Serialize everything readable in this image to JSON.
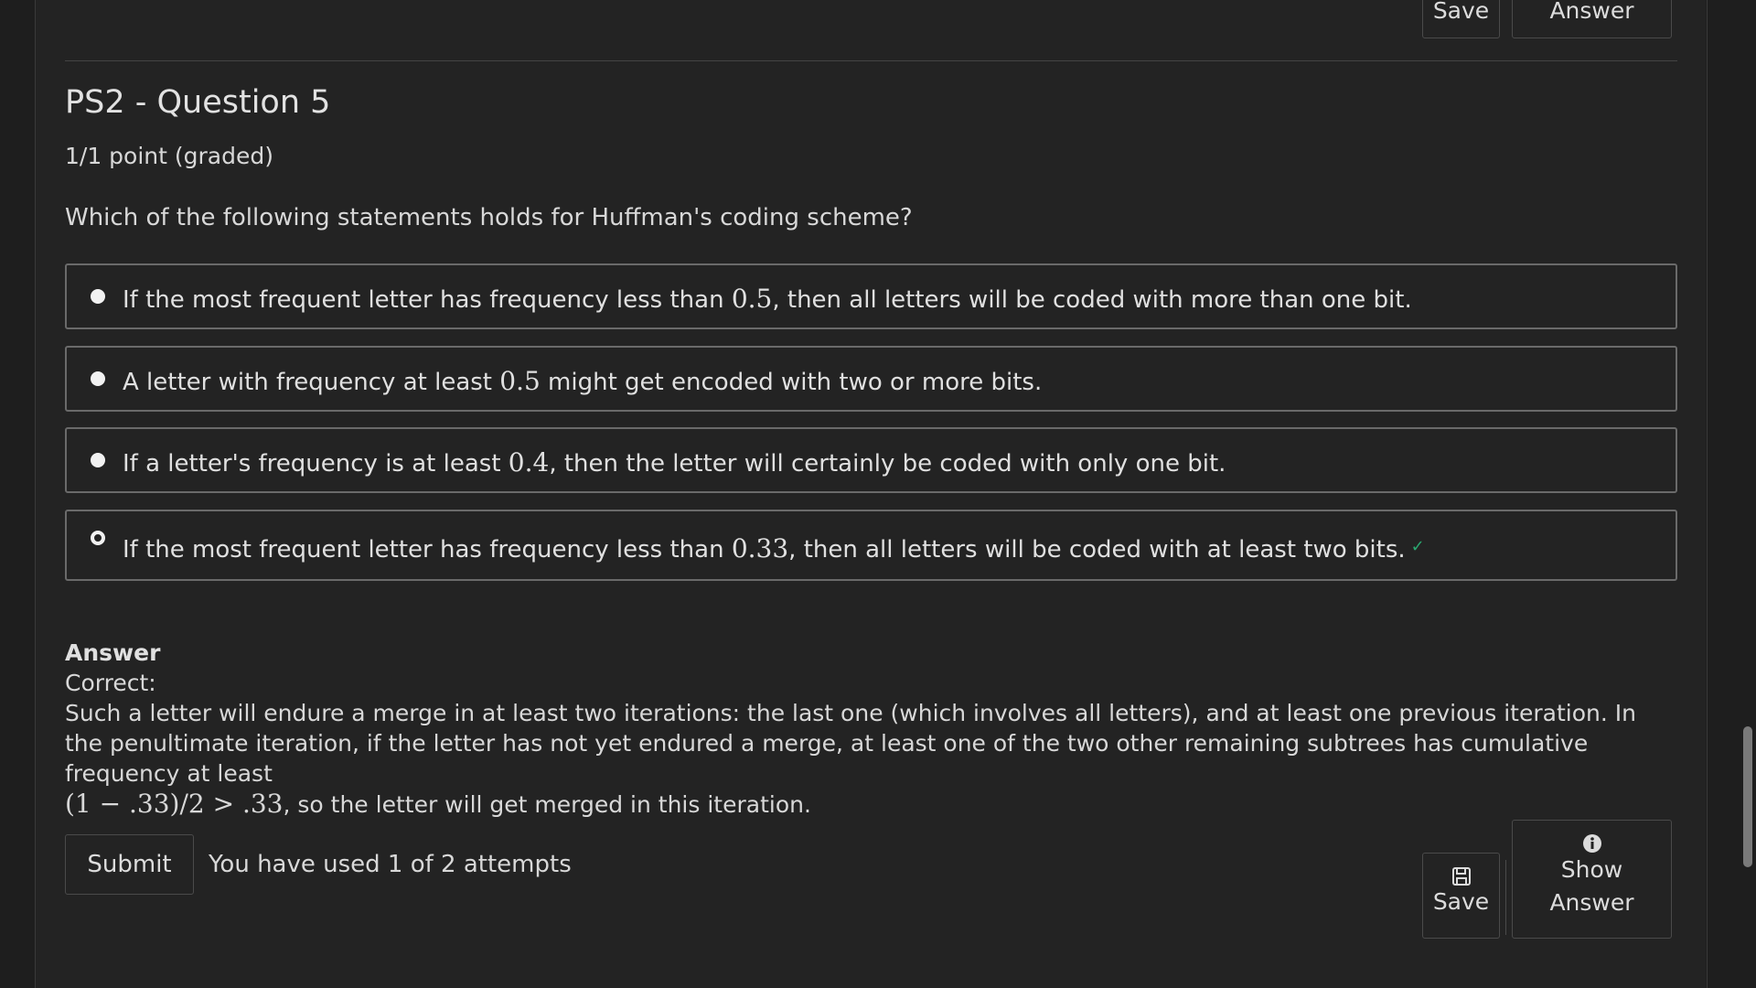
{
  "top_actions": {
    "save_label": "Save",
    "answer_label": "Answer"
  },
  "question": {
    "title": "PS2 - Question 5",
    "points": "1/1 point (graded)",
    "prompt": "Which of the following statements holds for Huffman's coding scheme?"
  },
  "options": [
    {
      "pre": "If the most frequent letter has frequency less than ",
      "math": "0.5",
      "post": ", then all letters will be coded with more than one bit.",
      "selected": false
    },
    {
      "pre": "A letter with frequency at least ",
      "math": "0.5",
      "post": " might get encoded with two or more bits.",
      "selected": false
    },
    {
      "pre": "If a letter's frequency is at least ",
      "math": "0.4",
      "post": ", then the letter will certainly be coded with only one bit.",
      "selected": false
    },
    {
      "pre": "If the most frequent letter has frequency less than ",
      "math": "0.33",
      "post": ", then all letters will be coded with at least two bits.",
      "selected": true
    }
  ],
  "answer": {
    "heading": "Answer",
    "status": "Correct:",
    "explanation": "Such a letter will endure a merge in at least two iterations: the last one (which involves all letters), and at least one previous iteration. In the penultimate iteration, if the letter has not yet endured a merge, at least one of the two other remaining subtrees has cumulative frequency at least",
    "math": "(1 − .33)/2 > .33",
    "explanation_end": ", so the letter will get merged in this iteration."
  },
  "footer": {
    "submit_label": "Submit",
    "attempts_text": "You have used 1 of 2 attempts",
    "save_label": "Save",
    "show_label": "Show",
    "answer_label": "Answer"
  },
  "icons": {
    "save": "floppy-disk-icon",
    "info": "info-circle-icon",
    "correct": "checkmark-icon"
  },
  "colors": {
    "background": "#232323",
    "border": "#6a6a6a",
    "correct": "#2aa870"
  }
}
